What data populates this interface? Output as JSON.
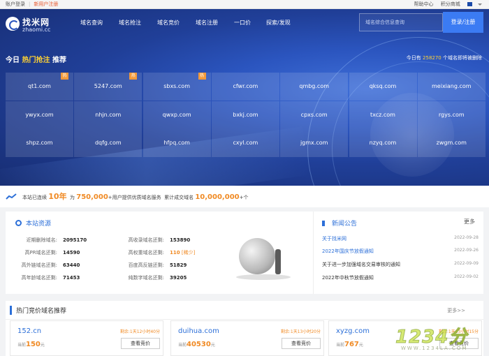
{
  "topbar": {
    "login": "账户登录",
    "register": "新用户注册",
    "help": "帮助中心",
    "points_mall": "积分商城"
  },
  "header": {
    "logo_name": "找米网",
    "logo_domain": "zhaomi.cc",
    "nav": [
      "域名查询",
      "域名抢注",
      "域名竞价",
      "域名注册",
      "一口价",
      "探索/发现"
    ],
    "search_placeholder": "域名综合信息查询",
    "login_button": "登录/注册"
  },
  "hot": {
    "prefix": "今日",
    "highlight": "热门抢注",
    "suffix": "推荐",
    "count_prefix": "今日有",
    "count": "258270",
    "count_suffix": "个域名即将被删除",
    "hot_tag": "热",
    "domains": [
      {
        "name": "qt1.com",
        "hot": true
      },
      {
        "name": "5247.com",
        "hot": true
      },
      {
        "name": "sbxs.com",
        "hot": true
      },
      {
        "name": "cfwr.com",
        "hot": false
      },
      {
        "name": "qmbg.com",
        "hot": false
      },
      {
        "name": "qksq.com",
        "hot": false
      },
      {
        "name": "meixiang.com",
        "hot": false
      },
      {
        "name": "ywyx.com",
        "hot": false
      },
      {
        "name": "nhjn.com",
        "hot": false
      },
      {
        "name": "qwxp.com",
        "hot": false
      },
      {
        "name": "bxkj.com",
        "hot": false
      },
      {
        "name": "cpxs.com",
        "hot": false
      },
      {
        "name": "txcz.com",
        "hot": false
      },
      {
        "name": "rgys.com",
        "hot": false
      },
      {
        "name": "shpz.com",
        "hot": false
      },
      {
        "name": "dqfg.com",
        "hot": false
      },
      {
        "name": "hfpq.com",
        "hot": false
      },
      {
        "name": "cxyl.com",
        "hot": false
      },
      {
        "name": "jgmx.com",
        "hot": false
      },
      {
        "name": "nzyq.com",
        "hot": false
      },
      {
        "name": "zwgm.com",
        "hot": false
      }
    ]
  },
  "stats": {
    "t1": "本站已连续",
    "years": "10年",
    "t2": "为",
    "users": "750,000",
    "t3": "+用户提供优质域名服务",
    "t4": "累计成交域名",
    "deals": "10,000,000",
    "t5": "+个"
  },
  "resources": {
    "title": "本站资源",
    "rows": [
      {
        "label": "近期删除域名:",
        "value": "2095170"
      },
      {
        "label": "高PR域名还剩:",
        "value": "14590"
      },
      {
        "label": "高外链域名还剩:",
        "value": "63440"
      },
      {
        "label": "高年龄域名还剩:",
        "value": "71453"
      },
      {
        "label": "高收录域名还剩:",
        "value": "153890"
      },
      {
        "label": "高权重域名还剩:",
        "value": "110"
      },
      {
        "label": "百度高反链还剩:",
        "value": "51829"
      },
      {
        "label": "纯数字域名还剩:",
        "value": "39205"
      }
    ],
    "scarce_tag": "[稀少]"
  },
  "news": {
    "title": "新闻公告",
    "more": "更多",
    "items": [
      {
        "title": "关于找米网",
        "date": "2022-09-28"
      },
      {
        "title": "2022年国庆节放假通知",
        "date": "2022-09-26"
      },
      {
        "title": "关于进一步加强域名交易审核的通知",
        "date": "2022-09-09"
      },
      {
        "title": "2022年中秋节放假通知",
        "date": "2022-09-02"
      }
    ]
  },
  "auction": {
    "title": "热门竞价域名推荐",
    "more": "更多>>",
    "current_label": "当前",
    "currency": "元",
    "bid_button": "查看竞价",
    "items": [
      {
        "domain": "152.cn",
        "remaining": "剩余:1天12小时40分",
        "price": "150"
      },
      {
        "domain": "duihua.com",
        "remaining": "剩余:1天13小时20分",
        "price": "40530"
      },
      {
        "domain": "xyzg.com",
        "remaining": "剩余:1天13小时15分",
        "price": "767"
      }
    ]
  },
  "watermark": {
    "big": "1234分",
    "small": "WWW.1234LA.COM"
  },
  "colors": {
    "brand_blue": "#2c6fd8",
    "hero_dark": "#172d72",
    "accent_orange": "#f08a24",
    "highlight_yellow": "#ffd233",
    "login_button": "#3b7bf3"
  }
}
